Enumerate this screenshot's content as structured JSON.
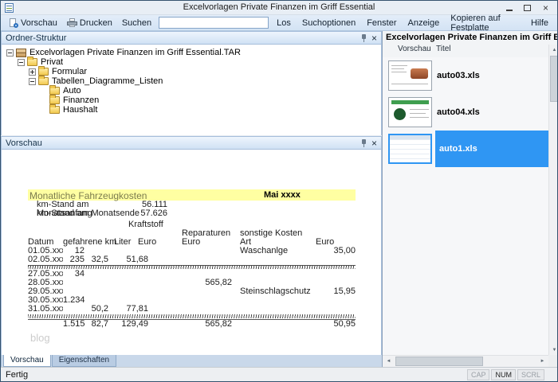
{
  "window": {
    "title": "Excelvorlagen Private Finanzen im Griff Essential"
  },
  "icons": {
    "close": "×",
    "up": "▲",
    "down": "▼",
    "left": "◄",
    "right": "►"
  },
  "toolbar": {
    "vorschau": "Vorschau",
    "drucken": "Drucken",
    "suchen": "Suchen",
    "search_value": "",
    "los": "Los",
    "suchoptionen": "Suchoptionen",
    "fenster": "Fenster",
    "anzeige": "Anzeige",
    "kopieren": "Kopieren auf Festplatte",
    "hilfe": "Hilfe"
  },
  "folder_panel": {
    "title": "Ordner-Struktur",
    "tree": [
      {
        "label": "Excelvorlagen Private Finanzen im Griff Essential.TAR"
      },
      {
        "label": "Privat"
      },
      {
        "label": "Formular"
      },
      {
        "label": "Tabellen_Diagramme_Listen"
      },
      {
        "label": "Auto"
      },
      {
        "label": "Finanzen"
      },
      {
        "label": "Haushalt"
      }
    ]
  },
  "preview_panel": {
    "title": "Vorschau",
    "watermark": "blog"
  },
  "sheet": {
    "title": "Monatliche Fahrzeugkosten",
    "month": "Mai xxxx",
    "km_start_label": "km-Stand am Monatsanfang",
    "km_start_value": "56.111",
    "km_end_label": "km-Stand am Monatsende",
    "km_end_value": "57.626",
    "group1": "Kraftstoff",
    "group2": "Reparaturen",
    "group3": "sonstige Kosten",
    "h_datum": "Datum",
    "h_km": "gefahrene km",
    "h_liter": "Liter",
    "h_euro1": "Euro",
    "h_euro2": "Euro",
    "h_art": "Art",
    "h_euro3": "Euro",
    "rows": [
      {
        "datum": "01.05.xxxx",
        "km": "12",
        "liter": "",
        "euro": "",
        "rep": "",
        "art": "Waschanlge",
        "sonst": "35,00"
      },
      {
        "datum": "02.05.xxxx",
        "km": "235",
        "liter": "32,5",
        "euro": "51,68",
        "rep": "",
        "art": "",
        "sonst": ""
      },
      {
        "datum": "27.05.xxxx",
        "km": "34",
        "liter": "",
        "euro": "",
        "rep": "",
        "art": "",
        "sonst": ""
      },
      {
        "datum": "28.05.xxxx",
        "km": "",
        "liter": "",
        "euro": "",
        "rep": "565,82",
        "art": "",
        "sonst": ""
      },
      {
        "datum": "29.05.xxxx",
        "km": "",
        "liter": "",
        "euro": "",
        "rep": "",
        "art": "Steinschlagschutz",
        "sonst": "15,95"
      },
      {
        "datum": "30.05.xxxx",
        "km": "1.234",
        "liter": "",
        "euro": "",
        "rep": "",
        "art": "",
        "sonst": ""
      },
      {
        "datum": "31.05.xxxx",
        "km": "",
        "liter": "50,2",
        "euro": "77,81",
        "rep": "",
        "art": "",
        "sonst": ""
      }
    ],
    "totals": {
      "km": "1.515",
      "liter": "82,7",
      "euro": "129,49",
      "rep": "565,82",
      "sonst": "50,95"
    }
  },
  "file_panel": {
    "title": "Excelvorlagen Private Finanzen im Griff Essential.TAR:Pr",
    "col_vorschau": "Vorschau",
    "col_titel": "Titel",
    "files": [
      {
        "name": "auto03.xls"
      },
      {
        "name": "auto04.xls"
      },
      {
        "name": "auto1.xls"
      }
    ]
  },
  "bottom_tabs": {
    "vorschau": "Vorschau",
    "eigenschaften": "Eigenschaften"
  },
  "statusbar": {
    "status": "Fertig",
    "cap": "CAP",
    "num": "NUM",
    "scrl": "SCRL"
  }
}
